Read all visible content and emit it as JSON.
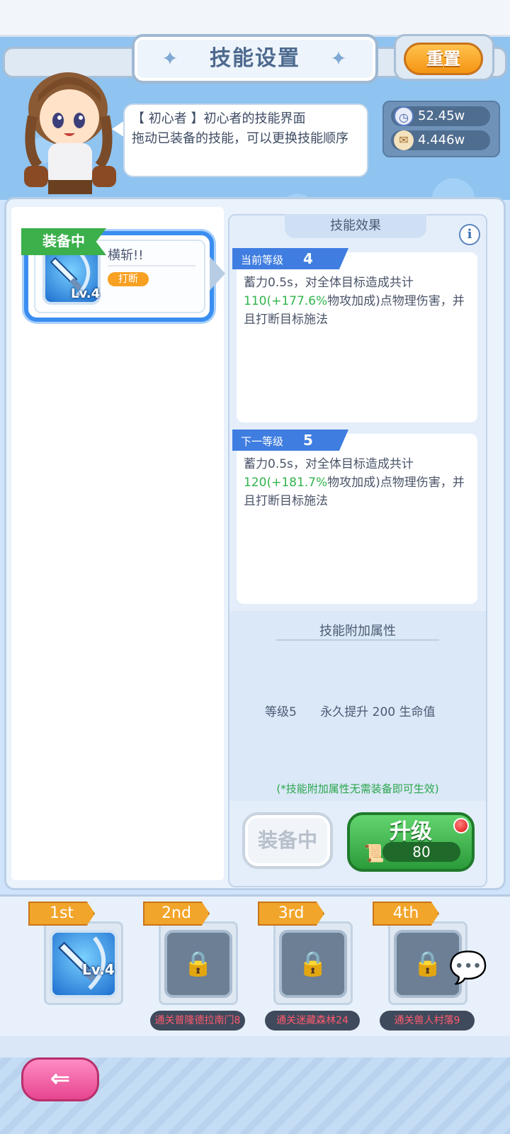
{
  "header": {
    "title": "技能设置",
    "reset_label": "重置"
  },
  "npc": {
    "speech": "【 初心者 】初心者的技能界面\n拖动已装备的技能，可以更换技能顺序"
  },
  "resources": [
    {
      "icon": "time-coin-icon",
      "value": "52.45w"
    },
    {
      "icon": "scroll-icon",
      "value": "4.446w"
    }
  ],
  "equipped_skill": {
    "flag": "装备中",
    "name": "横斩!!",
    "tag": "打断",
    "level": "Lv.4"
  },
  "effect": {
    "title": "技能效果",
    "info_symbol": "i",
    "current": {
      "label": "当前等级",
      "level": "4",
      "desc_a": "蓄力0.5s，对全体目标造成共计",
      "desc_b": "110(+177.6%",
      "desc_c": "物攻加成)点物理伤害，并且打断目标施法"
    },
    "next": {
      "label": "下一等级",
      "level": "5",
      "desc_a": "蓄力0.5s，对全体目标造成共计",
      "desc_b": "120(+181.7%",
      "desc_c": "物攻加成)点物理伤害，并且打断目标施法"
    }
  },
  "bonus": {
    "title": "技能附加属性",
    "level": "等级5",
    "text": "永久提升 200 生命值",
    "note": "(*技能附加属性无需装备即可生效)"
  },
  "actions": {
    "equip_label": "装备中",
    "upgrade_label": "升级",
    "upgrade_cost": "80"
  },
  "slots": [
    {
      "rank": "1st",
      "level": "Lv.4",
      "locked": false,
      "req": ""
    },
    {
      "rank": "2nd",
      "locked": true,
      "req": "通关普隆德拉南门8"
    },
    {
      "rank": "3rd",
      "locked": true,
      "req": "通关迷藏森林24"
    },
    {
      "rank": "4th",
      "locked": true,
      "req": "通关兽人村落9"
    }
  ],
  "colors": {
    "accent_blue": "#3a8ef0",
    "upgrade_green": "#2b9b3a",
    "reset_orange": "#f49413",
    "highlight_green": "#31b44b"
  }
}
